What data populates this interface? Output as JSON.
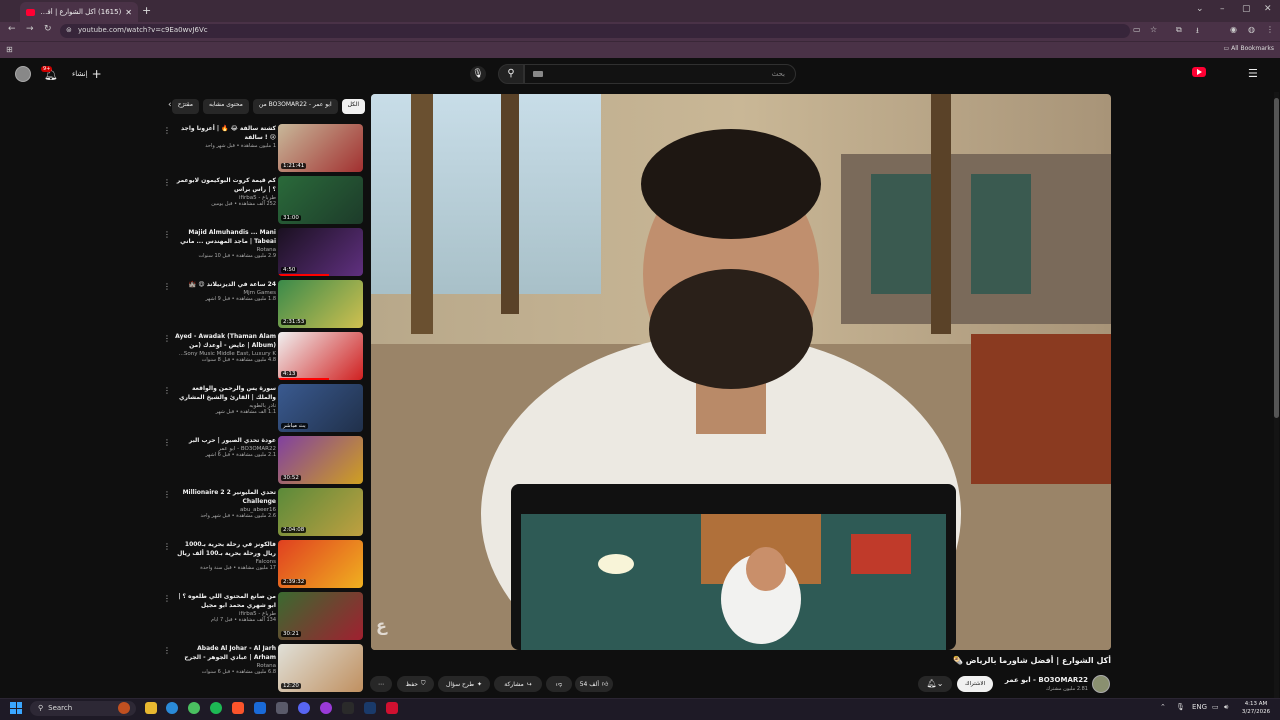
{
  "browser": {
    "tab_title": "(1615) أكل الشوارع | أفضل شاورما",
    "url": "youtube.com/watch?v=c9Ea0wvJ6Vc",
    "all_bookmarks": "All Bookmarks"
  },
  "youtube": {
    "search_placeholder": "بحث",
    "create_label": "إنشاء",
    "notif_count": "9+",
    "logo_text": "YouTube"
  },
  "chips": [
    "الكل",
    "من BO3OMAR22 - ابو عمر",
    "محتوى مشابه",
    "مقترَح"
  ],
  "recommendations": [
    {
      "title": "كشتة سالفة 😂 🔥 | أعزونا واجد 😢 ! سالفة",
      "channel": "",
      "meta": "1 مليون مشاهدة • قبل شهر واحد",
      "duration": "1:21:41",
      "thumb_colors": [
        "#c8b89a",
        "#a23030"
      ]
    },
    {
      "title": "كم قيمة كروت البوكيمون لابوعمر ؟ | راس براس",
      "channel": "طرباع - ifirba5",
      "meta": "252 ألف مشاهدة • قبل يومين",
      "duration": "31:00",
      "thumb_colors": [
        "#2a6a3a",
        "#1d3b2a"
      ]
    },
    {
      "title": "Majid Almuhandis ... Mani Tabeai | ماجد المهندس ... ماني طبيعي",
      "channel": "Rotana",
      "meta": "2.9 مليون مشاهدة • قبل 10 سنوات",
      "duration": "4:50",
      "thumb_colors": [
        "#1a1020",
        "#603080"
      ]
    },
    {
      "title": "24 ساعة في الديزنيلاند 😍 🏰",
      "channel": "Mjm Games",
      "meta": "1.8 مليون مشاهدة • قبل 9 أشهر",
      "duration": "2:31:53",
      "thumb_colors": [
        "#3a8a4a",
        "#d0c050"
      ]
    },
    {
      "title": "Ayed - Awadak (Thaman Alam Album) | عايض - أوعدك (من ألبوم ثمان...",
      "channel": "Sony Music Middle East, Luxury K...",
      "meta": "4.8 مليون مشاهدة • قبل 8 سنوات",
      "duration": "4:13",
      "thumb_colors": [
        "#f0f0f0",
        "#d02020"
      ]
    },
    {
      "title": "سورة يس والرحمن والواقعة والملك | القارئ والشيخ المشاري جودة عالية...",
      "channel": "نادر بالطوبه",
      "meta": "1.1 ألف مشاهدة • قبل شهر",
      "duration": "بث مباشر",
      "thumb_colors": [
        "#3a5a90",
        "#20304a"
      ]
    },
    {
      "title": "عودة تحدي الصبور | حرب البر",
      "channel": "BO3OMAR22 - ابو عمر",
      "meta": "2.1 مليون مشاهدة • قبل 6 أشهر",
      "duration": "30:52",
      "thumb_colors": [
        "#8040a0",
        "#d0a020"
      ]
    },
    {
      "title": "تحدي المليونير 2 Millionaire 2 Challenge",
      "channel": "abu_abeer16",
      "meta": "2.6 مليون مشاهدة • قبل شهر واحد",
      "duration": "2:04:08",
      "thumb_colors": [
        "#5a8a3a",
        "#c0a040"
      ]
    },
    {
      "title": "فالكونز في رحلة بحرية بـ1000 ريال ورحلة بحرية بـ100 ألف ريال 🔥 💰",
      "channel": "Falcons",
      "meta": "17 مليون مشاهدة • قبل سنة واحدة",
      "duration": "2:39:32",
      "thumb_colors": [
        "#e04020",
        "#f0b020"
      ]
    },
    {
      "title": "من صانع المحتوى اللي طلعوه ؟ | ابو شهري محمد ابو مجيل",
      "channel": "طرباع - ifirba5",
      "meta": "134 ألف مشاهدة • قبل 7 أيام",
      "duration": "30:21",
      "thumb_colors": [
        "#3a6a30",
        "#a02030"
      ]
    },
    {
      "title": "Abade Al Johar - Al Jarh Arham | عبادي الجوهر - الجرح ارحم",
      "channel": "Rotana",
      "meta": "6.8 مليون مشاهدة • قبل 6 سنوات",
      "duration": "12:20",
      "thumb_colors": [
        "#e0e0d8",
        "#c09060"
      ]
    }
  ],
  "video": {
    "title": "أكل الشوارع | أفضل شاورما بالرياض 🌯",
    "channel": "BO3OMAR22 - ابو عمر",
    "subscribers": "2.81 مليون مشترك",
    "joined_label": "الاشتراك",
    "likes": "54 ألف",
    "share": "مشاركة",
    "ask": "طرح سؤال",
    "save": "حفظ",
    "watermark": "ع"
  },
  "taskbar": {
    "search": "Search",
    "lang": "ENG",
    "time": "4:13 AM",
    "date": "3/27/2026"
  }
}
